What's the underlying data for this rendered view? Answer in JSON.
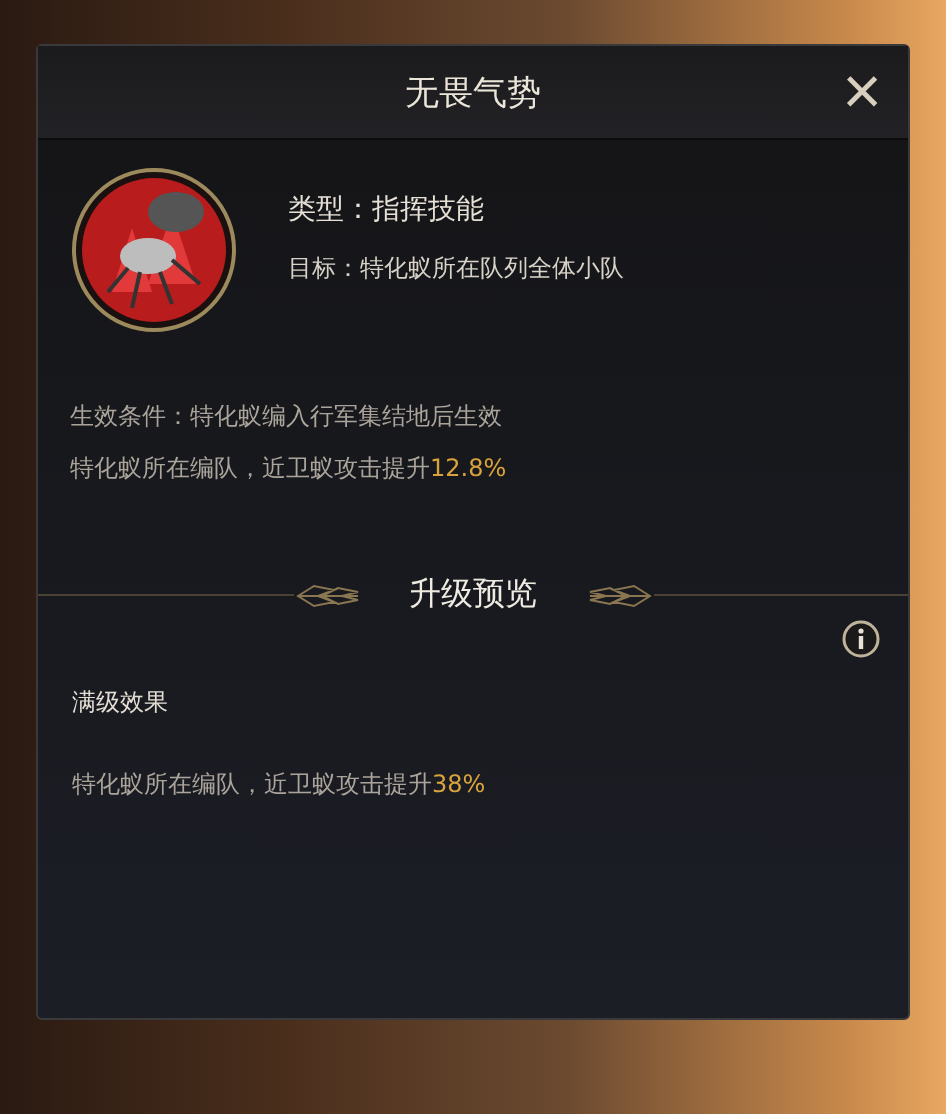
{
  "dialog": {
    "title": "无畏气势",
    "close_label": "×"
  },
  "skill": {
    "type_line": "类型：指挥技能",
    "target_line": "目标：特化蚁所在队列全体小队"
  },
  "details": [
    {
      "text": "生效条件：特化蚁编入行军集结地后生效"
    },
    {
      "text": "特化蚁所在编队，近卫蚁攻击提升",
      "value": "12.8%"
    }
  ],
  "upgrade": {
    "heading": "升级预览",
    "max_label": "满级效果",
    "effect": {
      "text": "特化蚁所在编队，近卫蚁攻击提升",
      "value": "38%"
    }
  }
}
